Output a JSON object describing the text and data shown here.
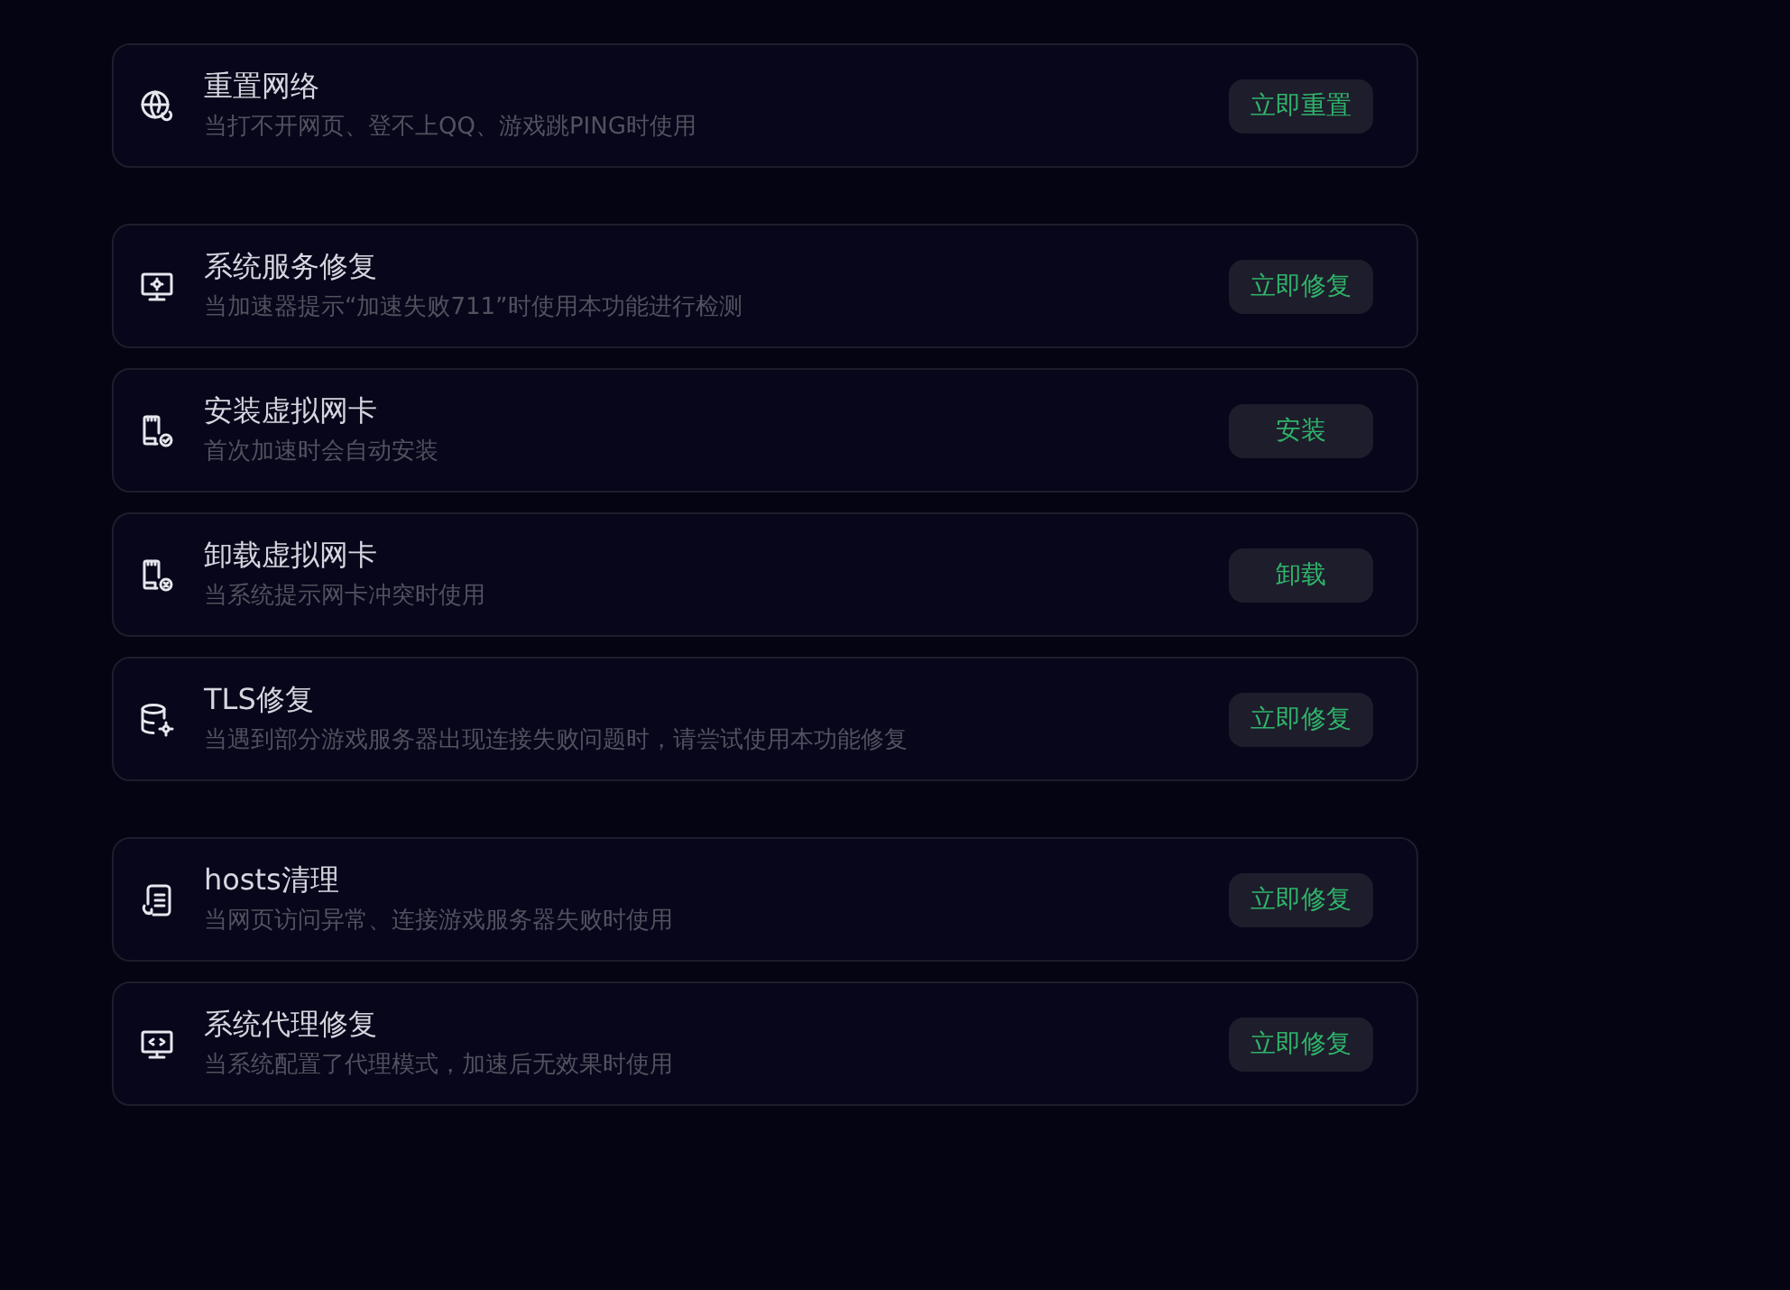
{
  "groups": [
    {
      "items": [
        {
          "kind": "globe",
          "title": "重置网络",
          "description": "当打不开网页、登不上QQ、游戏跳PING时使用",
          "action": "立即重置"
        }
      ]
    },
    {
      "items": [
        {
          "kind": "monitor-gear",
          "title": "系统服务修复",
          "description": "当加速器提示“加速失败711”时使用本功能进行检测",
          "action": "立即修复"
        },
        {
          "kind": "card-check",
          "title": "安装虚拟网卡",
          "description": "首次加速时会自动安装",
          "action": "安装"
        },
        {
          "kind": "card-x",
          "title": "卸载虚拟网卡",
          "description": "当系统提示网卡冲突时使用",
          "action": "卸载"
        },
        {
          "kind": "database-gear",
          "title": "TLS修复",
          "description": "当遇到部分游戏服务器出现连接失败问题时，请尝试使用本功能修复",
          "action": "立即修复"
        }
      ]
    },
    {
      "items": [
        {
          "kind": "list-refresh",
          "title": "hosts清理",
          "description": "当网页访问异常、连接游戏服务器失败时使用",
          "action": "立即修复"
        },
        {
          "kind": "monitor-code",
          "title": "系统代理修复",
          "description": "当系统配置了代理模式，加速后无效果时使用",
          "action": "立即修复"
        }
      ]
    }
  ]
}
